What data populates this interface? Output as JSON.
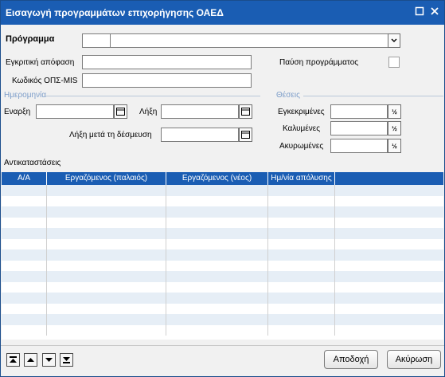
{
  "window": {
    "title": "Εισαγωγή προγραμμάτων επιχορήγησης ΟΑΕΔ",
    "icons": [
      "restore-icon",
      "close-icon"
    ]
  },
  "form": {
    "program_label": "Πρόγραμμα",
    "program_code": "",
    "program_name": "",
    "approval_label": "Εγκριτική απόφαση",
    "approval_value": "",
    "ops_label": "Κωδικός ΟΠΣ-MIS",
    "ops_value": "",
    "pause_label": "Παύση προγράμματος",
    "pause_checked": false
  },
  "dates": {
    "section_title": "Ημερομηνία",
    "start_label": "Εναρξη",
    "start_value": "",
    "end_label": "Λήξη",
    "end_value": "",
    "end_after_label": "Λήξη μετά τη δέσμευση",
    "end_after_value": ""
  },
  "positions": {
    "section_title": "Θέσεις",
    "approved_label": "Εγκεκριμένες",
    "approved_value": "",
    "covered_label": "Καλυμένες",
    "covered_value": "",
    "cancelled_label": "Ακυρωμένες",
    "cancelled_value": "",
    "calc_symbol": "½"
  },
  "replacements": {
    "title": "Αντικαταστάσεις",
    "columns": [
      "Α/Α",
      "Εργαζόμενος (παλαιός)",
      "Εργαζόμενος (νέος)",
      "Ημ/νία απόλυσης",
      ""
    ],
    "rows": []
  },
  "footer": {
    "ok_label": "Αποδοχή",
    "cancel_label": "Ακύρωση",
    "nav_icons": [
      "first-record-icon",
      "previous-record-icon",
      "next-record-icon",
      "last-record-icon"
    ]
  }
}
